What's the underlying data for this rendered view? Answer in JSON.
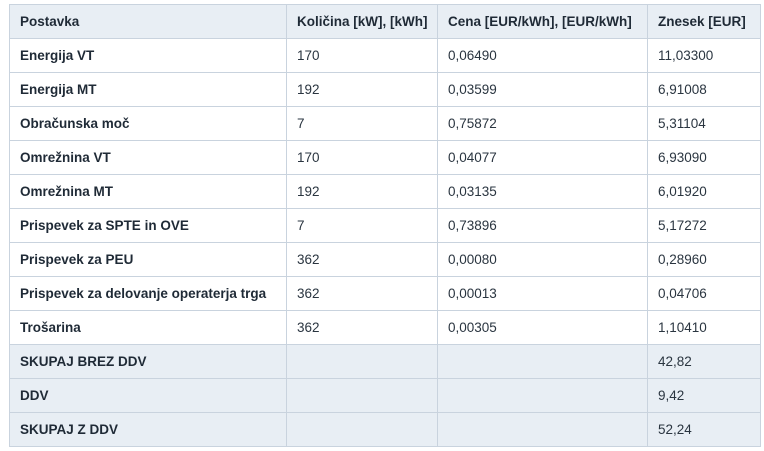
{
  "table": {
    "headers": [
      "Postavka",
      "Količina [kW], [kWh]",
      "Cena [EUR/kWh], [EUR/kWh]",
      "Znesek [EUR]"
    ],
    "rows": [
      [
        "Energija VT",
        "170",
        "0,06490",
        "11,03300"
      ],
      [
        "Energija MT",
        "192",
        "0,03599",
        "6,91008"
      ],
      [
        "Obračunska moč",
        "7",
        "0,75872",
        "5,31104"
      ],
      [
        "Omrežnina VT",
        "170",
        "0,04077",
        "6,93090"
      ],
      [
        "Omrežnina MT",
        "192",
        "0,03135",
        "6,01920"
      ],
      [
        "Prispevek za SPTE in OVE",
        "7",
        "0,73896",
        "5,17272"
      ],
      [
        "Prispevek za PEU",
        "362",
        "0,00080",
        "0,28960"
      ],
      [
        "Prispevek za delovanje operaterja trga",
        "362",
        "0,00013",
        "0,04706"
      ],
      [
        "Trošarina",
        "362",
        "0,00305",
        "1,10410"
      ]
    ],
    "summary": [
      [
        "SKUPAJ BREZ DDV",
        "",
        "",
        "42,82"
      ],
      [
        "DDV",
        "",
        "",
        "9,42"
      ],
      [
        "SKUPAJ Z DDV",
        "",
        "",
        "52,24"
      ]
    ]
  },
  "colors": {
    "header_bg": "#e8eef4",
    "border": "#c9d3de",
    "text": "#1f2a36"
  }
}
